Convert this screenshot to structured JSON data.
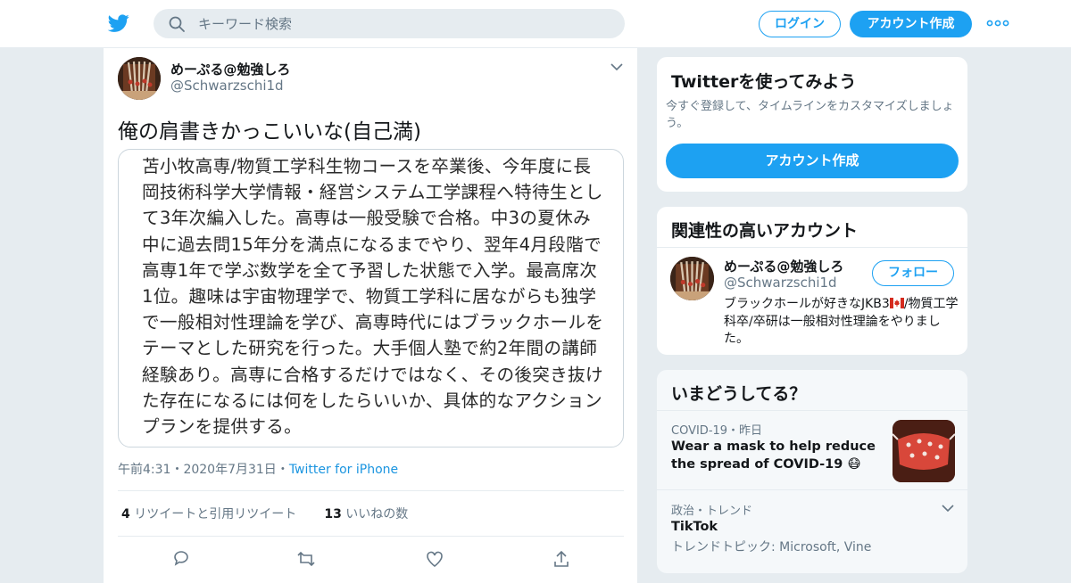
{
  "header": {
    "search_placeholder": "キーワード検索",
    "login_label": "ログイン",
    "signup_label": "アカウント作成"
  },
  "tweet": {
    "display_name": "めーぷる@勉強しろ",
    "handle": "@Schwarzschi1d",
    "text": "俺の肩書きかっこいいな(自己満)",
    "image_text": "苫小牧高専/物質工学科生物コースを卒業後、今年度に長岡技術科学大学情報・経営システム工学課程へ特待生として3年次編入した。高専は一般受験で合格。中3の夏休み中に過去問15年分を満点になるまでやり、翌年4月段階で高専1年で学ぶ数学を全て予習した状態で入学。最高席次1位。趣味は宇宙物理学で、物質工学科に居ながらも独学で一般相対性理論を学び、高専時代にはブラックホールをテーマとした研究を行った。大手個人塾で約2年間の講師経験あり。高専に合格するだけではなく、その後突き抜けた存在になるには何をしたらいいか、具体的なアクションプランを提供する。",
    "time": "午前4:31",
    "date": "2020年7月31日",
    "sep": "・",
    "source": "Twitter for iPhone",
    "retweets": "4",
    "retweets_label": "リツイートと引用リツイート",
    "likes": "13",
    "likes_label": "いいねの数"
  },
  "signup_box": {
    "title": "Twitterを使ってみよう",
    "description": "今すぐ登録して、タイムラインをカスタマイズしましょう。",
    "button": "アカウント作成"
  },
  "related": {
    "title": "関連性の高いアカウント",
    "display_name": "めーぷる@勉強しろ",
    "handle": "@Schwarzschi1d",
    "follow_label": "フォロー",
    "bio_prefix": "ブラックホールが好きなJKB3",
    "bio_suffix": "/物質工学科卒/卒研は一般相対性理論をやりました。"
  },
  "trends": {
    "title": "いまどうしてる？",
    "items": [
      {
        "context": "COVID-19・昨日",
        "headline": "Wear a mask to help reduce the spread of COVID-19 😷"
      },
      {
        "context": "政治・トレンド",
        "headline": "TikTok",
        "sub": "トレンドトピック: Microsoft, Vine"
      }
    ]
  },
  "colors": {
    "accent": "#1da1f2",
    "link": "#1b95e0",
    "muted": "#657786",
    "background": "#e6ecf0"
  }
}
